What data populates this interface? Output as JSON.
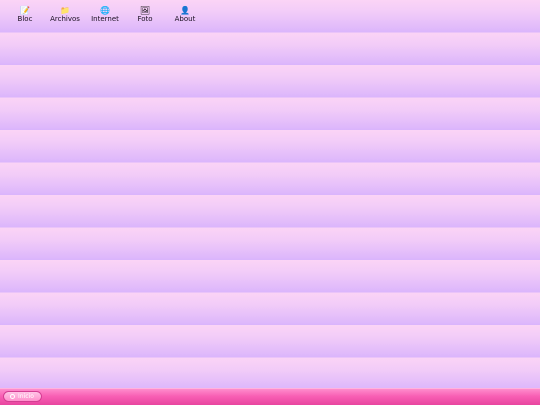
{
  "desktop": {
    "icons": [
      {
        "name": "bloc-icon",
        "glyph": "📝",
        "label": "Bloc"
      },
      {
        "name": "archivos-icon",
        "glyph": "📁",
        "label": "Archivos"
      },
      {
        "name": "internet-icon",
        "glyph": "🌐",
        "label": "Internet"
      },
      {
        "name": "foto-icon",
        "glyph": "🖼",
        "label": "Foto"
      },
      {
        "name": "about-icon",
        "glyph": "👤",
        "label": "About"
      }
    ]
  },
  "taskbar": {
    "start_label": "Inicio",
    "colors": {
      "bar": "#f85fb4",
      "button": "#ff9fd4"
    }
  }
}
